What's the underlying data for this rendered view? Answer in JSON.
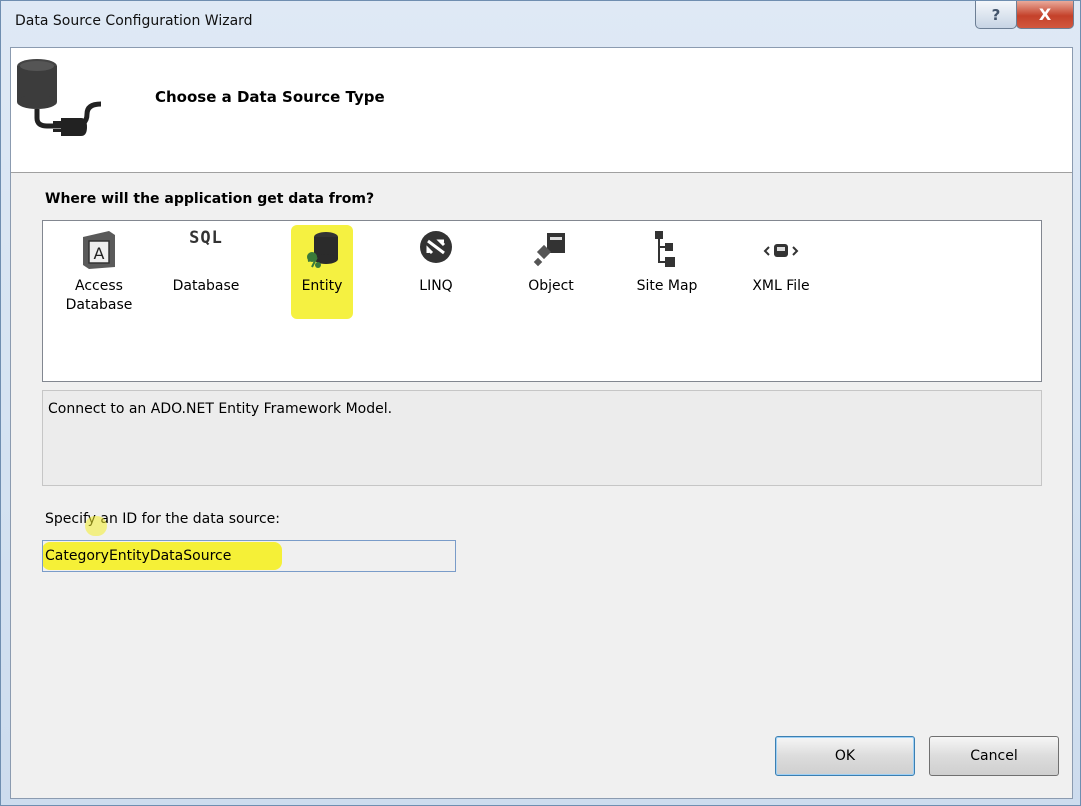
{
  "window": {
    "title": "Data Source Configuration Wizard",
    "help_glyph": "?",
    "close_glyph": "X"
  },
  "header": {
    "title": "Choose a Data Source Type"
  },
  "prompt": "Where will the application get data from?",
  "sources": [
    {
      "label": "Access\nDatabase",
      "icon": "access-database-icon"
    },
    {
      "label": "Database",
      "icon": "sql-database-icon",
      "icon_text": "SQL"
    },
    {
      "label": "Entity",
      "icon": "entity-icon",
      "selected": true
    },
    {
      "label": "LINQ",
      "icon": "linq-icon"
    },
    {
      "label": "Object",
      "icon": "object-icon"
    },
    {
      "label": "Site Map",
      "icon": "site-map-icon"
    },
    {
      "label": "XML File",
      "icon": "xml-file-icon"
    }
  ],
  "description": "Connect to an ADO.NET Entity Framework Model.",
  "id_field": {
    "label": "Specify an ID for the data source:",
    "value": "CategoryEntityDataSource"
  },
  "buttons": {
    "ok": "OK",
    "cancel": "Cancel"
  },
  "colors": {
    "highlight": "#f4ef2c",
    "selection_border": "#3c7fb1"
  }
}
